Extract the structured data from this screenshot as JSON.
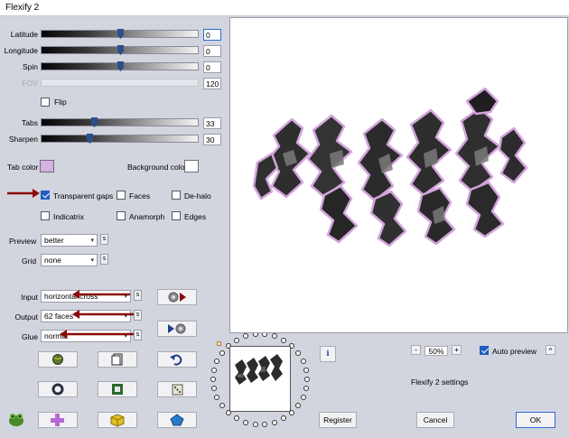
{
  "window": {
    "title": "Flexify 2"
  },
  "sliders": {
    "latitude": {
      "label": "Latitude",
      "value": "0",
      "position": 0.5
    },
    "longitude": {
      "label": "Longitude",
      "value": "0",
      "position": 0.5
    },
    "spin": {
      "label": "Spin",
      "value": "0",
      "position": 0.5
    },
    "fov": {
      "label": "FOV",
      "value": "120"
    },
    "tabs": {
      "label": "Tabs",
      "value": "33",
      "position": 0.33
    },
    "sharpen": {
      "label": "Sharpen",
      "value": "30",
      "position": 0.3
    }
  },
  "flip": {
    "label": "Flip",
    "checked": false
  },
  "colors": {
    "tab_color": {
      "label": "Tab color",
      "value": "#d6b0e0"
    },
    "background_color": {
      "label": "Background color",
      "value": "#ffffff"
    }
  },
  "options": {
    "transparent_gaps": {
      "label": "Transparent gaps",
      "checked": true
    },
    "faces": {
      "label": "Faces",
      "checked": false
    },
    "de_halo": {
      "label": "De-halo",
      "checked": false
    },
    "indicatrix": {
      "label": "Indicatrix",
      "checked": false
    },
    "anamorph": {
      "label": "Anamorph",
      "checked": false
    },
    "edges": {
      "label": "Edges",
      "checked": false
    }
  },
  "preview_quality": {
    "label": "Preview",
    "value": "better"
  },
  "grid": {
    "label": "Grid",
    "value": "none"
  },
  "input": {
    "label": "Input",
    "value": "horizontal cross"
  },
  "output": {
    "label": "Output",
    "value": "62 faces"
  },
  "glue": {
    "label": "Glue",
    "value": "normal"
  },
  "s_label": "s",
  "zoom": {
    "minus": "-",
    "value": "50%",
    "plus": "+"
  },
  "auto_preview": {
    "label": "Auto preview",
    "checked": true
  },
  "caret_label": "^",
  "info_label": "i",
  "settings_label": "Flexify 2 settings",
  "buttons": {
    "register": "Register",
    "cancel": "Cancel",
    "ok": "OK"
  },
  "accent_color": "#1f5fbf",
  "arrow_color": "#8b0a0a"
}
